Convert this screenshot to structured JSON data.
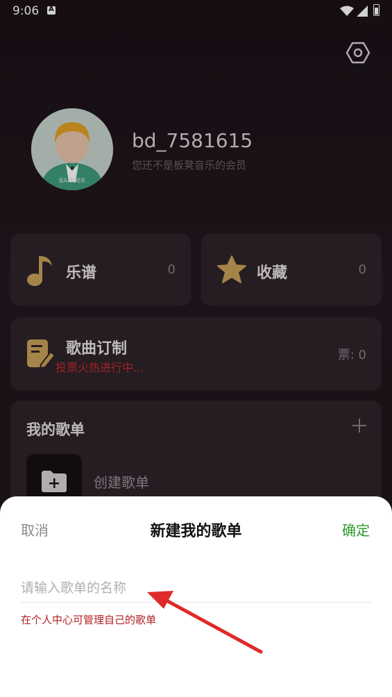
{
  "status": {
    "time": "9:06",
    "notification_glyph": "A"
  },
  "profile": {
    "username": "bd_7581615",
    "membership": "您还不是板凳音乐的会员",
    "avatar_text": "BANDER"
  },
  "cards": {
    "scores": {
      "label": "乐谱",
      "count": "0"
    },
    "favorites": {
      "label": "收藏",
      "count": "0"
    },
    "custom": {
      "label": "歌曲订制",
      "sub": "投票火热进行中...",
      "votes": "票: 0"
    }
  },
  "playlist": {
    "title": "我的歌单",
    "create_label": "创建歌单"
  },
  "sheet": {
    "cancel": "取消",
    "title": "新建我的歌单",
    "confirm": "确定",
    "input_placeholder": "请输入歌单的名称",
    "input_value": "",
    "hint": "在个人中心可管理自己的歌单"
  },
  "colors": {
    "accent_gold": "#c9a25a",
    "confirm_green": "#2a9a2a",
    "hint_red": "#b02020",
    "arrow_red": "#e02a2a"
  }
}
